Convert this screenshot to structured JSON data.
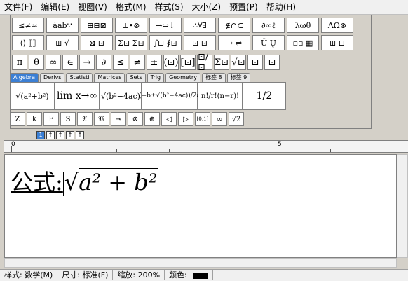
{
  "menu": [
    "文件(F)",
    "编辑(E)",
    "视图(V)",
    "格式(M)",
    "样式(S)",
    "大小(Z)",
    "预置(P)",
    "帮助(H)"
  ],
  "palette_row1": [
    "≤≠≈",
    "ȧab∵",
    "⊞⊟⊠",
    "±•⊗",
    "→⇔↓",
    "∴∀∃",
    "∉∩⊂",
    "∂∞ℓ",
    "λωθ",
    "ΛΩ⊛"
  ],
  "palette_row2": [
    "⟨⟩ ⟦⟧",
    "⊞ √",
    "⊠ ⊡",
    "Σ⊡ Σ⊡",
    "∫⊡ ∮⊡",
    "⊡ ⊡",
    "→ ⇌",
    "Ū Ų",
    "▫▫ ▦",
    "⊞ ⊟"
  ],
  "symbols_row": [
    "π",
    "θ",
    "∞",
    "∈",
    "→",
    "∂",
    "≤",
    "≠",
    "±",
    "(⊡)",
    "[⊡]",
    "⊡/⊡",
    "Σ⊡",
    "√⊡",
    "⊡",
    "⊡"
  ],
  "tabs": [
    "Algebra",
    "Derivs",
    "Statisti",
    "Matrices",
    "Sets",
    "Trig",
    "Geometry",
    "标签 8",
    "标签 9"
  ],
  "templates": [
    "√(a²+b²)",
    "lim x→∞",
    "√(b²−4ac)",
    "(−b±√(b²−4ac))/2a",
    "n!/r!(n−r)!",
    "1/2"
  ],
  "small_row": [
    "Z",
    "k",
    "F",
    "S",
    "𝔄",
    "𝔐",
    "⊸",
    "⊗",
    "⊕",
    "◁",
    "▷",
    "[0,1]",
    "∞",
    "√2"
  ],
  "nav_buttons": [
    "1",
    "↑",
    "↑",
    "↑",
    "↑"
  ],
  "ruler": {
    "start": "0",
    "mid": "5"
  },
  "formula": {
    "label": "公式:",
    "expression": "a² + b²"
  },
  "status": {
    "style_label": "样式: 数学(M)",
    "size_label": "尺寸: 标准(F)",
    "zoom_label": "缩放: 200%",
    "color_label": "颜色:",
    "color_value": "#000000"
  }
}
